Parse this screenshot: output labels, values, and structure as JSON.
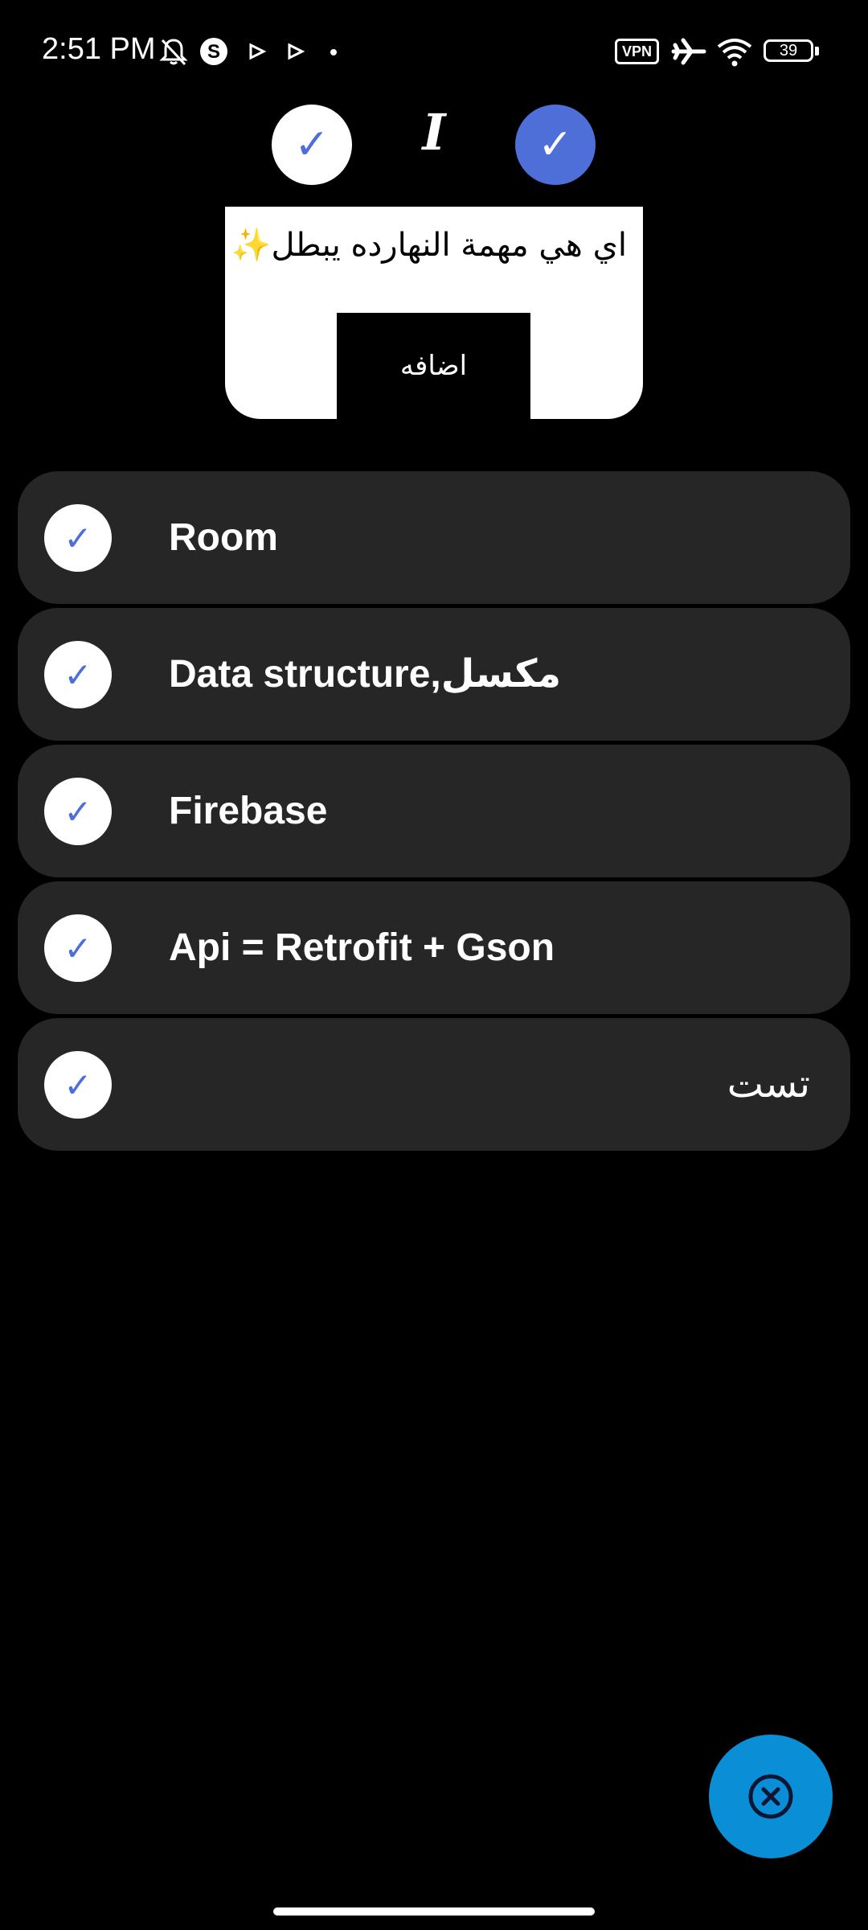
{
  "status_bar": {
    "time": "2:51 PM",
    "vpn": "VPN",
    "battery": "39",
    "icons": [
      "bell-off-icon",
      "s-app-icon",
      "play-icon",
      "play-icon",
      "dot-icon",
      "vpn-icon",
      "airplane-icon",
      "wifi-icon",
      "battery-icon"
    ]
  },
  "top_controls": {
    "check_symbol": "✓",
    "italic_symbol": "I"
  },
  "input": {
    "prompt_text": "اي هي مهمة النهارده يبطل✨",
    "add_label": "اضافه"
  },
  "tasks": [
    {
      "label": "Room",
      "done": true
    },
    {
      "label": "Data structure,مكسل",
      "done": true
    },
    {
      "label": "Firebase",
      "done": true
    },
    {
      "label": "Api = Retrofit + Gson",
      "done": true
    },
    {
      "label": "تست",
      "done": true
    }
  ],
  "fab": {
    "icon": "close-circle-icon"
  },
  "colors": {
    "background": "#000000",
    "card": "#262626",
    "accent_blue": "#4f6fd8",
    "fab": "#0a8fd6"
  }
}
